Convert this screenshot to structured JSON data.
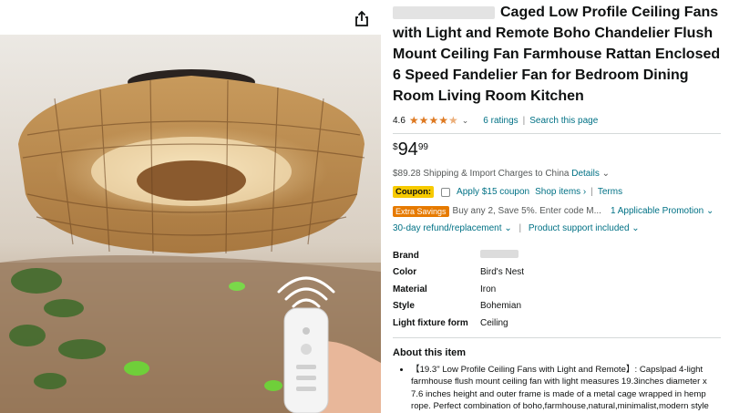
{
  "product": {
    "title": "Caged Low Profile Ceiling Fans with Light and Remote Boho Chandelier Flush Mount Ceiling Fan Farmhouse Rattan Enclosed 6 Speed Fandelier Fan for Bedroom Dining Room Living Room Kitchen",
    "rating_value": "4.6",
    "rating_stars": 4.5,
    "ratings_count": "6 ratings",
    "search_link": "Search this page",
    "price_symbol": "$",
    "price_whole": "94",
    "price_fraction": "99",
    "shipping_amount": "$89.28",
    "shipping_text": "Shipping & Import Charges to China",
    "shipping_details": "Details",
    "coupon_badge": "Coupon:",
    "coupon_text": "Apply $15 coupon",
    "shop_items": "Shop items",
    "terms": "Terms",
    "savings_badge": "Extra Savings",
    "savings_text": "Buy any 2, Save 5%. Enter code M...",
    "promotion_link": "1 Applicable Promotion",
    "returns_link": "30-day refund/replacement",
    "support_link": "Product support included"
  },
  "specs": [
    {
      "key": "Brand",
      "value": ""
    },
    {
      "key": "Color",
      "value": "Bird's Nest"
    },
    {
      "key": "Material",
      "value": "Iron"
    },
    {
      "key": "Style",
      "value": "Bohemian"
    },
    {
      "key": "Light fixture form",
      "value": "Ceiling"
    }
  ],
  "about": {
    "title": "About this item",
    "bullets": [
      "【19.3\" Low Profile Ceiling Fans with Light and Remote】: Capslpad 4-light farmhouse flush mount ceiling fan with light measures 19.3inches diameter x 7.6 inches height and outer frame is made of a metal cage wrapped in hemp rope. Perfect combination of boho,farmhouse,natural,minimalist,modern style for home decoration."
    ]
  },
  "icons": {
    "share": "share-icon",
    "chevron": "chevron-down-icon",
    "star": "star-icon"
  },
  "colors": {
    "link": "#007185",
    "star": "#de7921",
    "coupon": "#f7ca00",
    "savings": "#e67a00"
  }
}
